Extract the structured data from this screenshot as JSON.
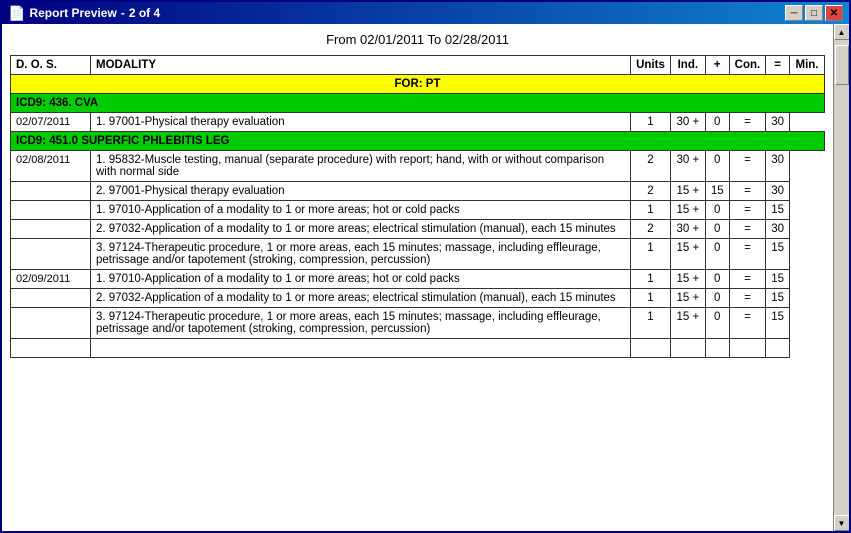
{
  "window": {
    "title": "Report Preview",
    "page_info": "2 of   4"
  },
  "title_bar_buttons": {
    "minimize": "─",
    "maximize": "□",
    "close": "✕"
  },
  "report": {
    "date_range": "From 02/01/2011 To 02/28/2011",
    "columns": {
      "dos": "D. O. S.",
      "modality": "MODALITY",
      "units": "Units",
      "ind": "Ind.",
      "plus1": "+",
      "con": "Con.",
      "eq": "=",
      "min": "Min."
    },
    "for_label": "FOR: PT",
    "sections": [
      {
        "icd_label": "ICD9:  436.       CVA",
        "rows": [
          {
            "dos": "02/07/2011",
            "modality": "1. 97001-Physical therapy evaluation",
            "units": "1",
            "ind": "30 +",
            "con": "0",
            "eq": "=",
            "min": "30"
          }
        ]
      },
      {
        "icd_label": "ICD9:  451.0       SUPERFIC PHLEBITIS LEG",
        "rows": [
          {
            "dos": "02/08/2011",
            "modality": "1. 95832-Muscle testing, manual (separate procedure)  with report; hand, with or without comparison with  normal side",
            "units": "2",
            "ind": "30 +",
            "con": "0",
            "eq": "=",
            "min": "30"
          },
          {
            "dos": "",
            "modality": "2. 97001-Physical therapy evaluation",
            "units": "2",
            "ind": "15 +",
            "con": "15",
            "eq": "=",
            "min": "30"
          },
          {
            "dos": "",
            "modality": "1. 97010-Application of a modality to 1 or more  areas; hot or cold packs",
            "units": "1",
            "ind": "15 +",
            "con": "0",
            "eq": "=",
            "min": "15"
          },
          {
            "dos": "",
            "modality": "2. 97032-Application of a modality to 1 or more  areas; electrical stimulation (manual), each 15  minutes",
            "units": "2",
            "ind": "30 +",
            "con": "0",
            "eq": "=",
            "min": "30"
          },
          {
            "dos": "",
            "modality": "3. 97124-Therapeutic procedure, 1 or more areas, each  15 minutes; massage, including effleurage,  petrissage and/or tapotement (stroking, compression, percussion)",
            "units": "1",
            "ind": "15 +",
            "con": "0",
            "eq": "=",
            "min": "15"
          },
          {
            "dos": "02/09/2011",
            "modality": "1. 97010-Application of a modality to 1 or more  areas; hot or cold packs",
            "units": "1",
            "ind": "15 +",
            "con": "0",
            "eq": "=",
            "min": "15"
          },
          {
            "dos": "",
            "modality": "2. 97032-Application of a modality to 1 or more  areas; electrical stimulation (manual), each 15  minutes",
            "units": "1",
            "ind": "15 +",
            "con": "0",
            "eq": "=",
            "min": "15"
          },
          {
            "dos": "",
            "modality": "3. 97124-Therapeutic procedure, 1 or more areas, each  15 minutes; massage, including effleurage,  petrissage and/or tapotement (stroking, compression, percussion)",
            "units": "1",
            "ind": "15 +",
            "con": "0",
            "eq": "=",
            "min": "15"
          }
        ]
      }
    ]
  }
}
